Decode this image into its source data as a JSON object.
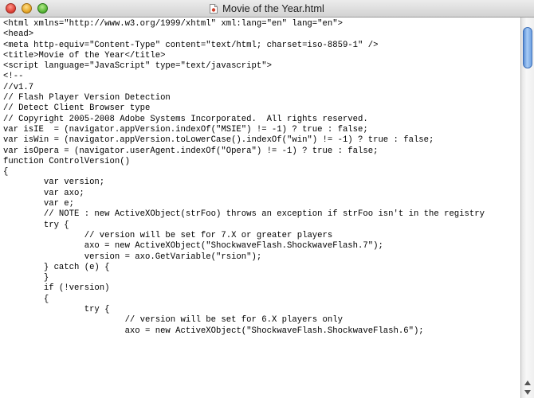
{
  "window": {
    "title": "Movie of the Year.html",
    "controls": [
      "close-button",
      "minimize-button",
      "zoom-button"
    ]
  },
  "document_icon": "html-document-icon",
  "scrollbar": {
    "thumb_position": 0.03,
    "accent_color": "#6fa0e0"
  },
  "code_lines": [
    "<html xmlns=\"http://www.w3.org/1999/xhtml\" xml:lang=\"en\" lang=\"en\">",
    "<head>",
    "<meta http-equiv=\"Content-Type\" content=\"text/html; charset=iso-8859-1\" />",
    "<title>Movie of the Year</title>",
    "<script language=\"JavaScript\" type=\"text/javascript\">",
    "<!--",
    "//v1.7",
    "// Flash Player Version Detection",
    "// Detect Client Browser type",
    "// Copyright 2005-2008 Adobe Systems Incorporated.  All rights reserved.",
    "var isIE  = (navigator.appVersion.indexOf(\"MSIE\") != -1) ? true : false;",
    "var isWin = (navigator.appVersion.toLowerCase().indexOf(\"win\") != -1) ? true : false;",
    "var isOpera = (navigator.userAgent.indexOf(\"Opera\") != -1) ? true : false;",
    "function ControlVersion()",
    "{",
    "\tvar version;",
    "\tvar axo;",
    "\tvar e;",
    "\t// NOTE : new ActiveXObject(strFoo) throws an exception if strFoo isn't in the registry",
    "\ttry {",
    "\t\t// version will be set for 7.X or greater players",
    "\t\taxo = new ActiveXObject(\"ShockwaveFlash.ShockwaveFlash.7\");",
    "\t\tversion = axo.GetVariable(\"rsion\");",
    "\t} catch (e) {",
    "\t}",
    "\tif (!version)",
    "\t{",
    "\t\ttry {",
    "\t\t\t// version will be set for 6.X players only",
    "\t\t\taxo = new ActiveXObject(\"ShockwaveFlash.ShockwaveFlash.6\");"
  ]
}
